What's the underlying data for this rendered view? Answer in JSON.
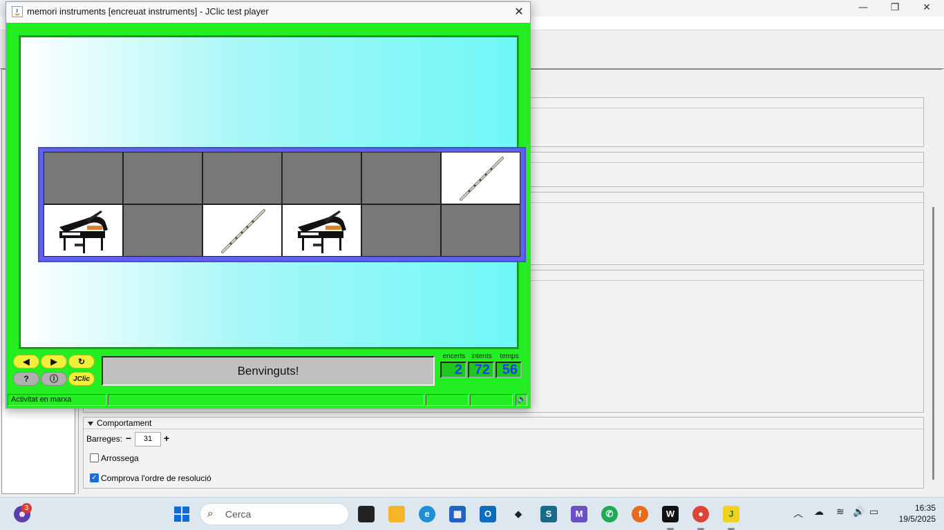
{
  "player": {
    "title": "memori instruments [encreuat instruments] - JClic test player",
    "close_label": "✕",
    "message": "Benvinguts!",
    "counters": {
      "hits_label": "encerts",
      "hits_value": "2",
      "tries_label": "intents",
      "tries_value": "72",
      "time_label": "temps",
      "time_value": "56"
    },
    "status_text": "Activitat en marxa",
    "buttons": {
      "prev": "◀",
      "next": "▶",
      "restart": "↻",
      "help": "?",
      "info": "ⓘ",
      "jclic": "JClic"
    },
    "cells": [
      {
        "state": "hidden",
        "image": ""
      },
      {
        "state": "hidden",
        "image": ""
      },
      {
        "state": "hidden",
        "image": ""
      },
      {
        "state": "hidden",
        "image": ""
      },
      {
        "state": "hidden",
        "image": ""
      },
      {
        "state": "revealed",
        "image": "flute"
      },
      {
        "state": "revealed",
        "image": "grand-piano"
      },
      {
        "state": "hidden",
        "image": ""
      },
      {
        "state": "revealed",
        "image": "flute"
      },
      {
        "state": "revealed",
        "image": "grand-piano"
      },
      {
        "state": "hidden",
        "image": ""
      },
      {
        "state": "hidden",
        "image": ""
      }
    ],
    "colors": {
      "frame": "#22ee22",
      "hidden_cell": "#787878",
      "board": "#6060ee",
      "counter_text": "#1e3ef0"
    }
  },
  "editor": {
    "behaviour_title": "Comportament",
    "shuffle_label": "Barreges:",
    "shuffle_value": "31",
    "drag_label": "Arrossega",
    "drag_checked": false,
    "order_label": "Comprova l'ordre de resolució",
    "order_checked": true
  },
  "taskbar": {
    "search_placeholder": "Cerca",
    "notification_badge": "3",
    "time": "16:35",
    "date": "19/5/2025",
    "apps": [
      "start-icon",
      "search",
      "task-view-icon",
      "file-explorer-icon",
      "edge-icon",
      "store-icon",
      "outlook-icon",
      "dropbox-icon",
      "app-s-icon",
      "m365-icon",
      "whatsapp-icon",
      "firefox-icon",
      "webex-icon",
      "chrome-icon",
      "jclic-icon"
    ]
  }
}
